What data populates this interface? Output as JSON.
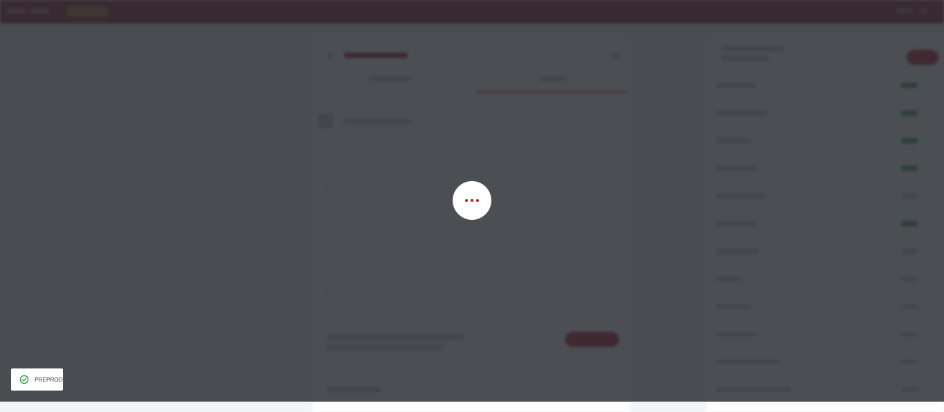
{
  "colors": {
    "brand": "#8d1a2a",
    "accent": "#b21f2d",
    "success": "#2e9c4a",
    "overlay": "rgba(40,44,50,0.84)"
  },
  "loader": {
    "icon": "more-horizontal-icon"
  },
  "environment_badge": {
    "label": "PREPROD",
    "icon": "check-circle-icon"
  }
}
